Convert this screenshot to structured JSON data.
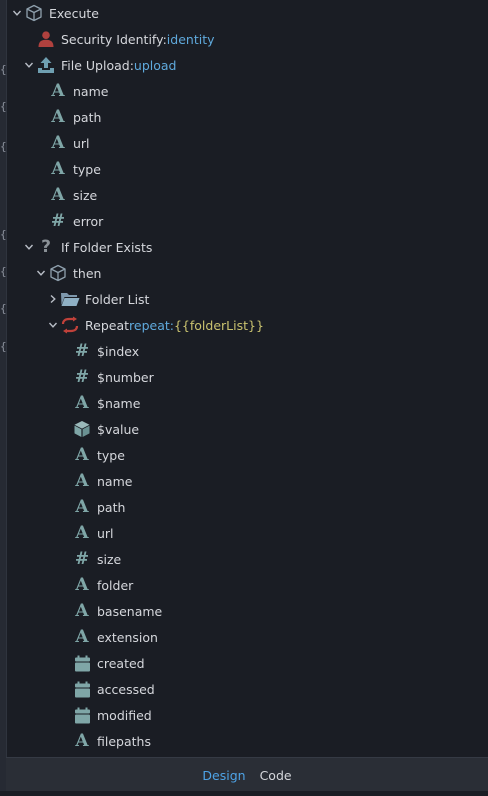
{
  "gutter": {
    "marks": [
      "{",
      "{",
      "{",
      "{",
      "{",
      "{",
      "{"
    ]
  },
  "tree": {
    "rows": [
      {
        "depth": 0,
        "twisty": "down",
        "icon": "cube-icon",
        "label": "Execute"
      },
      {
        "depth": 1,
        "twisty": "none",
        "icon": "user-icon",
        "label": "Security Identify:",
        "value": "identity"
      },
      {
        "depth": 1,
        "twisty": "down",
        "icon": "upload-icon",
        "label": "File Upload:",
        "value": "upload"
      },
      {
        "depth": 2,
        "twisty": "none",
        "icon": "text-type-icon",
        "label": "name"
      },
      {
        "depth": 2,
        "twisty": "none",
        "icon": "text-type-icon",
        "label": "path"
      },
      {
        "depth": 2,
        "twisty": "none",
        "icon": "text-type-icon",
        "label": "url"
      },
      {
        "depth": 2,
        "twisty": "none",
        "icon": "text-type-icon",
        "label": "type"
      },
      {
        "depth": 2,
        "twisty": "none",
        "icon": "text-type-icon",
        "label": "size"
      },
      {
        "depth": 2,
        "twisty": "none",
        "icon": "number-type-icon",
        "label": "error"
      },
      {
        "depth": 1,
        "twisty": "down",
        "icon": "question-icon",
        "label": "If Folder Exists"
      },
      {
        "depth": 2,
        "twisty": "down",
        "icon": "cube-icon",
        "label": "then"
      },
      {
        "depth": 3,
        "twisty": "right",
        "icon": "folder-open-icon",
        "label": "Folder List"
      },
      {
        "depth": 3,
        "twisty": "down",
        "icon": "repeat-icon",
        "label": "Repeat",
        "keyword": "repeat:",
        "expr": "{{folderList}}"
      },
      {
        "depth": 4,
        "twisty": "none",
        "icon": "number-type-icon",
        "label": "$index"
      },
      {
        "depth": 4,
        "twisty": "none",
        "icon": "number-type-icon",
        "label": "$number"
      },
      {
        "depth": 4,
        "twisty": "none",
        "icon": "text-type-icon",
        "label": "$name"
      },
      {
        "depth": 4,
        "twisty": "none",
        "icon": "object-type-icon",
        "label": "$value"
      },
      {
        "depth": 4,
        "twisty": "none",
        "icon": "text-type-icon",
        "label": "type"
      },
      {
        "depth": 4,
        "twisty": "none",
        "icon": "text-type-icon",
        "label": "name"
      },
      {
        "depth": 4,
        "twisty": "none",
        "icon": "text-type-icon",
        "label": "path"
      },
      {
        "depth": 4,
        "twisty": "none",
        "icon": "text-type-icon",
        "label": "url"
      },
      {
        "depth": 4,
        "twisty": "none",
        "icon": "number-type-icon",
        "label": "size"
      },
      {
        "depth": 4,
        "twisty": "none",
        "icon": "text-type-icon",
        "label": "folder"
      },
      {
        "depth": 4,
        "twisty": "none",
        "icon": "text-type-icon",
        "label": "basename"
      },
      {
        "depth": 4,
        "twisty": "none",
        "icon": "text-type-icon",
        "label": "extension"
      },
      {
        "depth": 4,
        "twisty": "none",
        "icon": "date-type-icon",
        "label": "created"
      },
      {
        "depth": 4,
        "twisty": "none",
        "icon": "date-type-icon",
        "label": "accessed"
      },
      {
        "depth": 4,
        "twisty": "none",
        "icon": "date-type-icon",
        "label": "modified"
      },
      {
        "depth": 4,
        "twisty": "none",
        "icon": "text-type-icon",
        "label": "filepaths"
      }
    ]
  },
  "footer": {
    "design_label": "Design",
    "code_label": "Code"
  },
  "colors": {
    "background": "#1a1d24",
    "value": "#5fa9dc",
    "expression": "#c9c26f",
    "type_icon": "#7fa6a7",
    "user_icon": "#b0413e",
    "repeat_icon": "#c0413a",
    "active_tab": "#4ea3e6"
  }
}
